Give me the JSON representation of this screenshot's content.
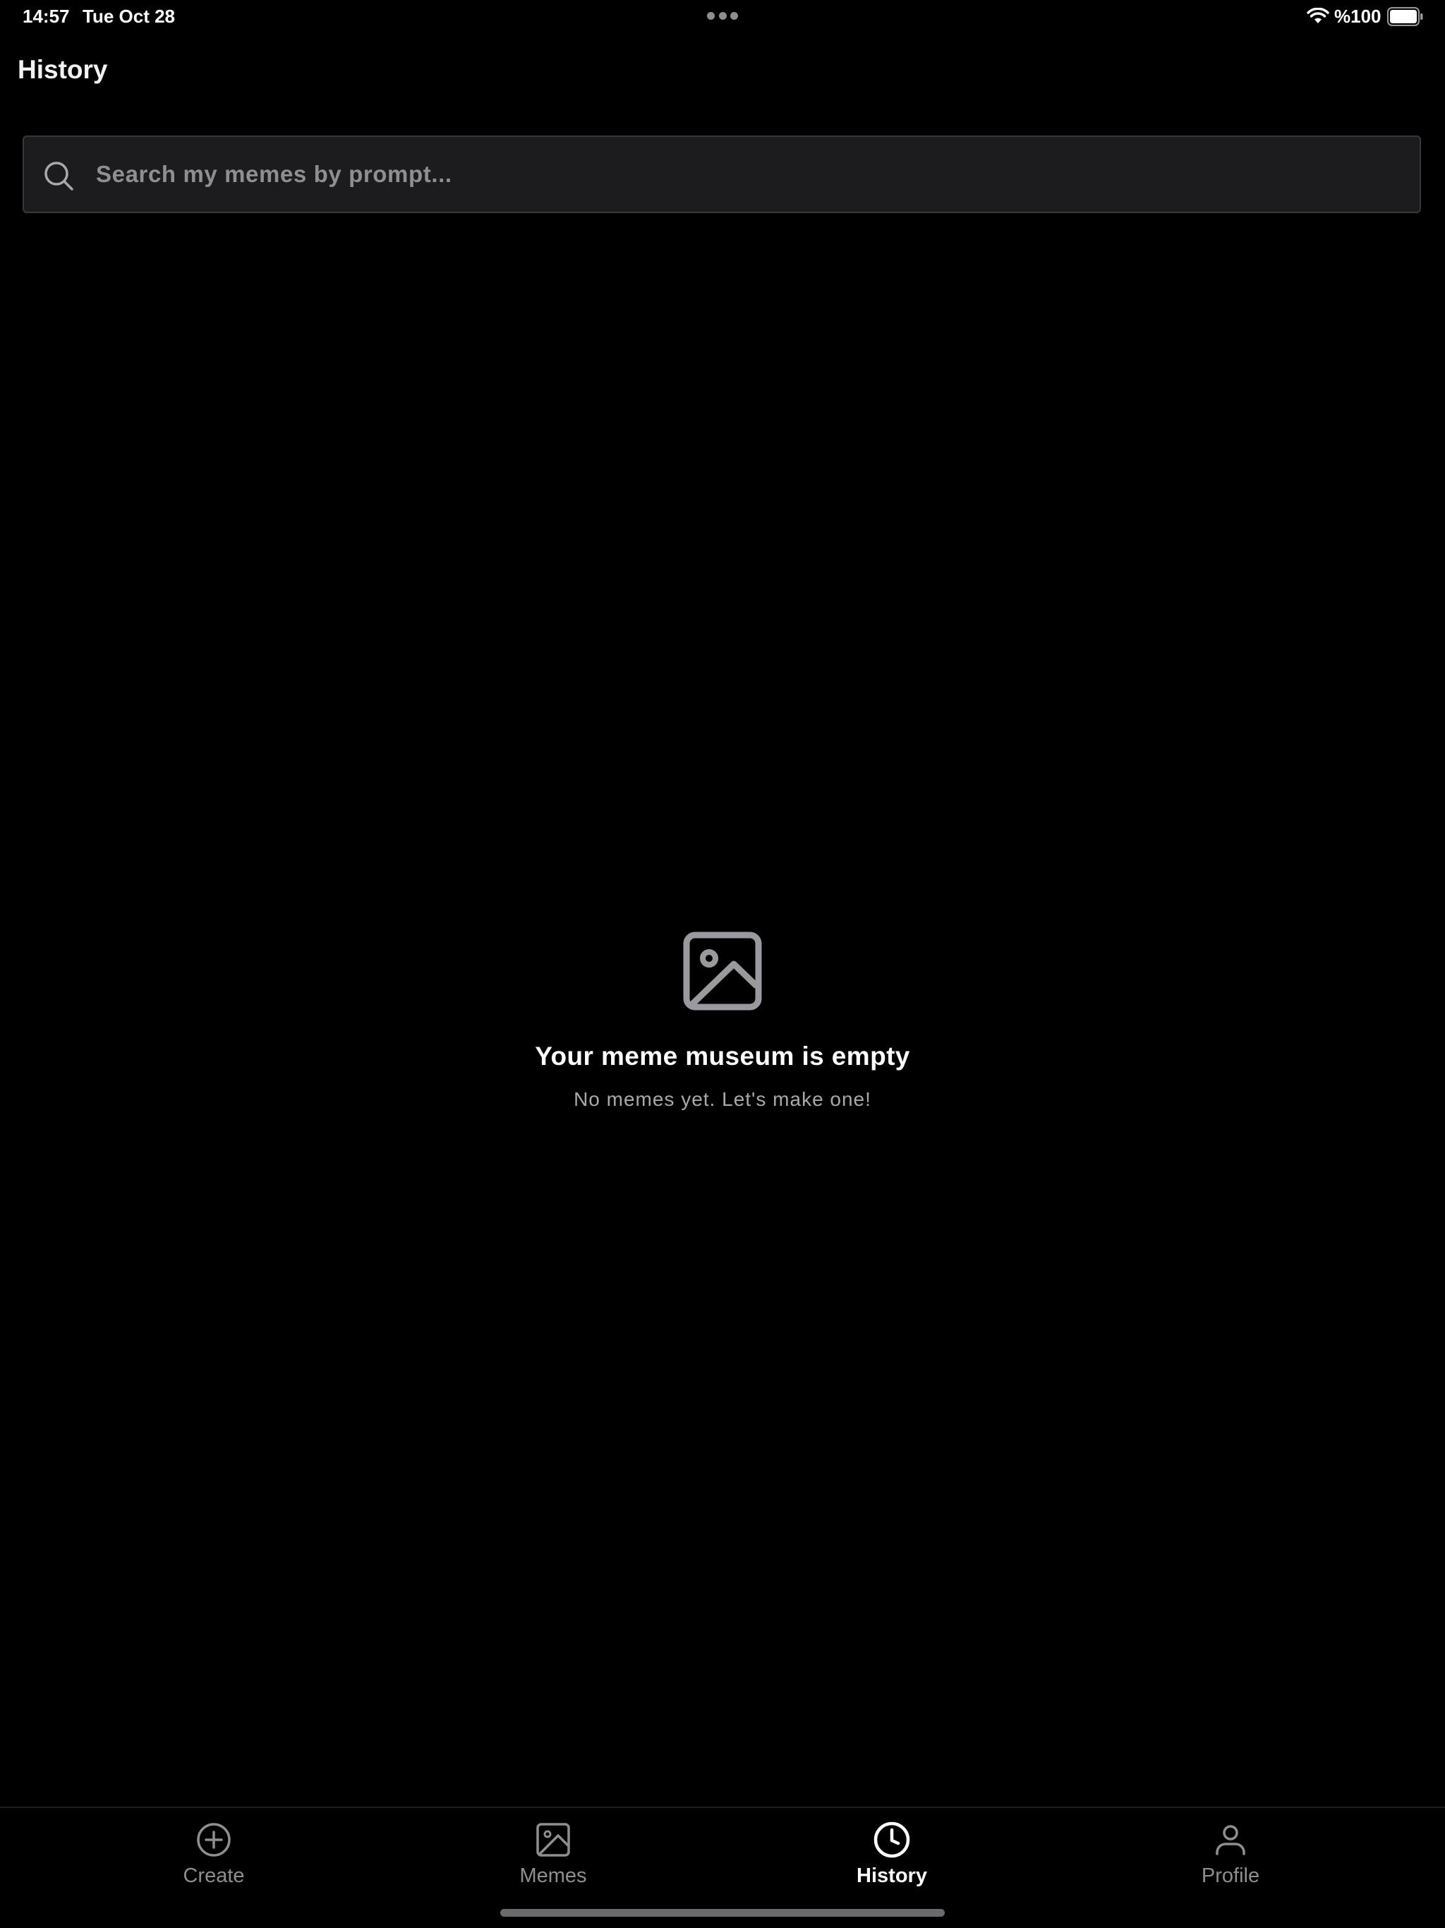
{
  "status_bar": {
    "time": "14:57",
    "date": "Tue Oct 28",
    "battery_percent": "%100",
    "battery_level": 1.0,
    "icons": [
      "multitask-dots-icon",
      "wifi-icon",
      "battery-icon"
    ]
  },
  "header": {
    "title": "History"
  },
  "search": {
    "placeholder": "Search my memes by prompt...",
    "value": ""
  },
  "empty_state": {
    "icon": "image-icon",
    "title": "Your meme museum is empty",
    "subtitle": "No memes yet. Let's make one!"
  },
  "tab_bar": {
    "active": "History",
    "tabs": [
      {
        "label": "Create",
        "icon": "plus-circle-icon"
      },
      {
        "label": "Memes",
        "icon": "image-icon"
      },
      {
        "label": "History",
        "icon": "clock-icon"
      },
      {
        "label": "Profile",
        "icon": "person-icon"
      }
    ]
  },
  "colors": {
    "background": "#000000",
    "search_background": "#1c1c1e",
    "search_border": "#38383a",
    "inactive": "#8e8e93",
    "active": "#ffffff"
  }
}
